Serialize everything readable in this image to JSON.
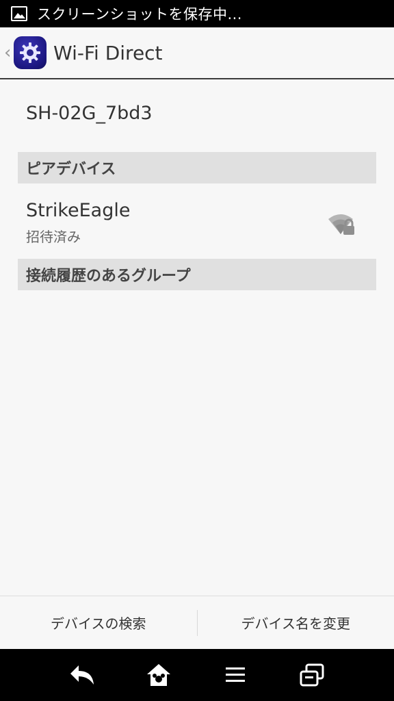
{
  "status_bar": {
    "notification_text": "スクリーンショットを保存中...",
    "icon": "image-icon"
  },
  "action_bar": {
    "title": "Wi-Fi Direct",
    "back_icon": "chevron-left-icon",
    "app_icon": "settings-gear-icon"
  },
  "device": {
    "name": "SH-02G_7bd3"
  },
  "peer_section": {
    "header": "ピアデバイス",
    "items": [
      {
        "name": "StrikeEagle",
        "status": "招待済み",
        "icon": "wifi-lock-icon"
      }
    ]
  },
  "groups_section": {
    "header": "接続履歴のあるグループ"
  },
  "bottom_buttons": {
    "search_label": "デバイスの検索",
    "rename_label": "デバイス名を変更"
  },
  "nav_bar": {
    "back": "back-icon",
    "home": "home-icon",
    "menu": "menu-icon",
    "recents": "recents-icon"
  },
  "colors": {
    "background": "#f7f7f7",
    "section_header": "#e0e0e0",
    "app_icon": "#1c1780"
  }
}
